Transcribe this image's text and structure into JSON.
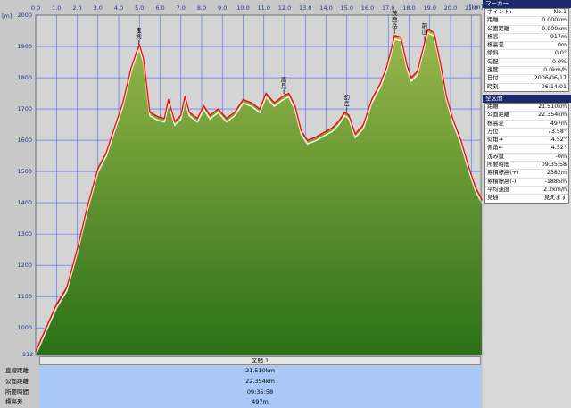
{
  "chart_data": {
    "type": "area",
    "y_unit": "[m]",
    "x_unit": "[km]",
    "xlim": [
      0,
      21.6
    ],
    "ylim": [
      912,
      2000
    ],
    "x_ticks": [
      "0.0",
      "1.0",
      "2.0",
      "3.0",
      "4.0",
      "5.0",
      "6.0",
      "7.0",
      "8.0",
      "9.0",
      "10.0",
      "11.0",
      "12.0",
      "13.0",
      "14.0",
      "15.0",
      "16.0",
      "17.0",
      "18.0",
      "19.0",
      "20.0",
      "21.0"
    ],
    "y_ticks": [
      "1000",
      "1100",
      "1200",
      "1300",
      "1400",
      "1500",
      "1600",
      "1700",
      "1800",
      "1900",
      "2000"
    ],
    "y_min_label": "912",
    "series": [
      {
        "x": [
          0,
          0.5,
          1.0,
          1.5,
          2.0,
          2.5,
          3.0,
          3.4,
          3.8,
          4.2,
          4.6,
          4.85,
          5.0,
          5.2,
          5.5,
          5.9,
          6.2,
          6.4,
          6.7,
          7.0,
          7.2,
          7.4,
          7.8,
          8.1,
          8.4,
          8.8,
          9.2,
          9.6,
          10.0,
          10.4,
          10.8,
          11.1,
          11.5,
          11.9,
          12.2,
          12.5,
          12.8,
          13.1,
          13.5,
          13.9,
          14.3,
          14.6,
          14.9,
          15.1,
          15.4,
          15.8,
          16.2,
          16.6,
          16.9,
          17.1,
          17.3,
          17.6,
          17.9,
          18.1,
          18.4,
          18.7,
          18.9,
          19.2,
          19.5,
          19.8,
          20.1,
          20.5,
          20.9,
          21.2,
          21.51
        ],
        "y": [
          925,
          1000,
          1075,
          1130,
          1250,
          1390,
          1510,
          1560,
          1640,
          1720,
          1830,
          1880,
          1905,
          1860,
          1690,
          1675,
          1670,
          1730,
          1660,
          1680,
          1740,
          1690,
          1670,
          1710,
          1680,
          1700,
          1670,
          1690,
          1730,
          1720,
          1700,
          1750,
          1720,
          1740,
          1750,
          1710,
          1630,
          1600,
          1610,
          1625,
          1640,
          1660,
          1690,
          1680,
          1620,
          1650,
          1730,
          1780,
          1830,
          1880,
          1935,
          1930,
          1840,
          1800,
          1820,
          1900,
          1955,
          1945,
          1850,
          1740,
          1670,
          1600,
          1510,
          1450,
          1410
        ]
      }
    ],
    "peaks": [
      {
        "label": "宝剣",
        "x": 4.97
      },
      {
        "label": "高見",
        "x": 11.96
      },
      {
        "label": "幻岳",
        "x": 15.0
      },
      {
        "label": "茂鹿岳",
        "x": 17.3
      },
      {
        "label": "前山",
        "x": 18.75
      }
    ],
    "colors": {
      "fill_top": "#9ab84c",
      "fill_bottom": "#2a7016",
      "line": "#ff0000",
      "shadow": "#ffffff",
      "grid": "#5060ff",
      "plot_bg": "#d4d4d4"
    }
  },
  "marker_panel": {
    "title": "マーカー",
    "rows": [
      {
        "k": "ポイント:",
        "v": "No.1"
      },
      {
        "k": "距離",
        "v": "0.000km"
      },
      {
        "k": "公面距離",
        "v": "0.000km"
      },
      {
        "k": "標高",
        "v": "917m"
      },
      {
        "k": "標高差",
        "v": "0m"
      },
      {
        "k": "傾斜",
        "v": "0.0°"
      },
      {
        "k": "勾配",
        "v": "0.0%"
      },
      {
        "k": "速度",
        "v": "0.0km/h"
      },
      {
        "k": "日付",
        "v": "2006/06/17"
      },
      {
        "k": "時刻",
        "v": "06:14:01"
      }
    ]
  },
  "section_panel": {
    "title": "全区間",
    "rows": [
      {
        "k": "距離",
        "v": "21.510km"
      },
      {
        "k": "公面距離",
        "v": "22.354km"
      },
      {
        "k": "標高差",
        "v": "497m"
      },
      {
        "k": "方位",
        "v": "73.58°"
      },
      {
        "k": "仰角→",
        "v": "-4.52°"
      },
      {
        "k": "俯角←",
        "v": "4.52°"
      },
      {
        "k": "沈み量",
        "v": "-0m"
      },
      {
        "k": "所要時間",
        "v": "09:35:58"
      },
      {
        "k": "累積標高(+)",
        "v": "2382m"
      },
      {
        "k": "累積標高(-)",
        "v": "-1885m"
      },
      {
        "k": "平均速度",
        "v": "2.2km/h"
      },
      {
        "k": "見通",
        "v": "見えます"
      }
    ]
  },
  "section_bar": {
    "label": "区間 1"
  },
  "summary": {
    "rows": [
      {
        "label": "直線距離",
        "value": "21.510km"
      },
      {
        "label": "公面距離",
        "value": "22.354km"
      },
      {
        "label": "所要時間",
        "value": "09:35:58"
      },
      {
        "label": "標高差",
        "value": "497m"
      }
    ]
  }
}
